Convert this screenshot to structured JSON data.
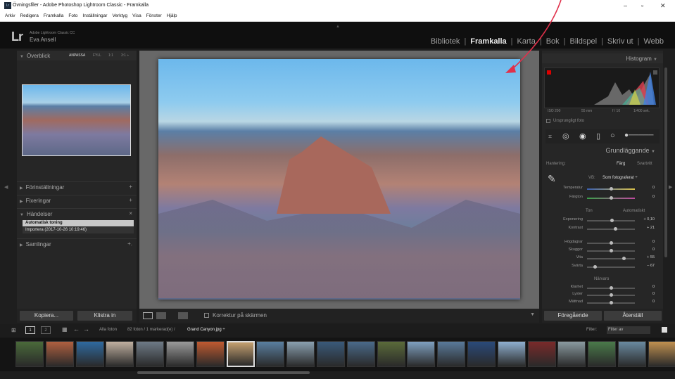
{
  "window": {
    "title": "Övningsfiler - Adobe Photoshop Lightroom Classic - Framkalla",
    "icon": "Lr",
    "min": "–",
    "max": "▫",
    "close": "✕"
  },
  "menu": [
    "Arkiv",
    "Redigera",
    "Framkalla",
    "Foto",
    "Inställningar",
    "Verktyg",
    "Visa",
    "Fönster",
    "Hjälp"
  ],
  "identity": {
    "logo": "Lr",
    "product": "Adobe Lightroom Classic CC",
    "user": "Eva Ansell"
  },
  "modules": [
    {
      "label": "Bibliotek"
    },
    {
      "label": "Framkalla",
      "active": true
    },
    {
      "label": "Karta"
    },
    {
      "label": "Bok"
    },
    {
      "label": "Bildspel"
    },
    {
      "label": "Skriv ut"
    },
    {
      "label": "Webb"
    }
  ],
  "left": {
    "navigator": {
      "title": "Överblick",
      "zoom": [
        "ANPASSA",
        "FYLL",
        "1:1",
        "3:1 ÷"
      ]
    },
    "sections": [
      {
        "label": "Förinställningar",
        "marker": "+"
      },
      {
        "label": "Fixeringar",
        "marker": "+"
      },
      {
        "label": "Händelser",
        "marker": "×"
      }
    ],
    "history": [
      "Automatisk toning",
      "Importera (2017-10-26 10:19:46)"
    ],
    "collections": {
      "label": "Samlingar",
      "marker": "+."
    },
    "copy": "Kopiera...",
    "paste": "Klistra in"
  },
  "centertb": {
    "softproof": "Korrektur på skärmen"
  },
  "right": {
    "histogram": {
      "title": "Histogram",
      "iso": "ISO 200",
      "focal": "55 mm",
      "aperture": "f / 10",
      "shutter": "1/400 sek.",
      "original": "Ursprungligt foto"
    },
    "basic": {
      "title": "Grundläggande",
      "treatment": "Hantering:",
      "color": "Färg",
      "bw": "Svartvitt",
      "wb_label": "VB:",
      "wb_value": "Som fotograferat ÷"
    },
    "sliders": [
      {
        "label": "Temperatur",
        "value": "0",
        "pos": 0.5
      },
      {
        "label": "Färgton",
        "value": "0",
        "pos": 0.5
      },
      {
        "label": "Exponering",
        "value": "+ 0,10",
        "pos": 0.52
      },
      {
        "label": "Kontrast",
        "value": "+ 21",
        "pos": 0.6
      },
      {
        "label": "Högdagrar",
        "value": "0",
        "pos": 0.5
      },
      {
        "label": "Skuggor",
        "value": "0",
        "pos": 0.5
      },
      {
        "label": "Vita",
        "value": "+ 55",
        "pos": 0.77
      },
      {
        "label": "Svärta",
        "value": "– 67",
        "pos": 0.17
      },
      {
        "label": "Klarhet",
        "value": "0",
        "pos": 0.5
      },
      {
        "label": "Lyster",
        "value": "0",
        "pos": 0.5
      },
      {
        "label": "Mättnad",
        "value": "0",
        "pos": 0.5
      }
    ],
    "tone": "Ton",
    "auto": "Automatiskt",
    "presence": "Närvaro",
    "prev": "Föregående",
    "reset": "Återställ"
  },
  "filmstrip": {
    "page1": "1",
    "page2": "2",
    "source": "Alla foton",
    "count": "82 foton / 1 markerad(e) /",
    "file": "Grand Canyon.jpg ÷",
    "filter": "Filter:",
    "filtervalue": "Filter av"
  },
  "colors": {
    "thumbs": [
      "#4a6a3a",
      "#b06040",
      "#2f6aa0",
      "#c0b0a0",
      "#6e7a86",
      "#9a9a9a",
      "#c05a30",
      "#c5a070",
      "#5a7fa0",
      "#8aa0b0",
      "#3a5a7a",
      "#4a6a8a",
      "#5b6b3a",
      "#7fa0c0",
      "#5a7a9a",
      "#2a4a7a",
      "#8fb0d0",
      "#7a2a2a",
      "#8a9aa0",
      "#4a7a4a",
      "#6a8aa0",
      "#c09050",
      "#6a6a6a"
    ]
  }
}
